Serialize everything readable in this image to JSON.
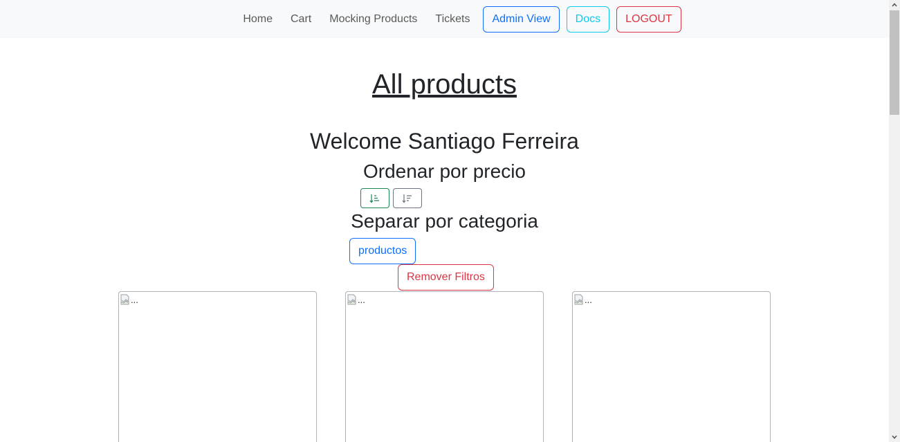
{
  "navbar": {
    "links": {
      "home": "Home",
      "cart": "Cart",
      "mocking": "Mocking Products",
      "tickets": "Tickets"
    },
    "buttons": {
      "admin": "Admin View",
      "docs": "Docs",
      "logout": "LOGOUT"
    }
  },
  "main": {
    "title": "All products",
    "welcome": "Welcome Santiago Ferreira",
    "order_heading": "Ordenar por precio",
    "sort_icons": [
      "sort-ascending-icon",
      "sort-descending-icon"
    ],
    "category_heading": "Separar por categoria",
    "category_button": "productos",
    "remove_filters": "Remover Filtros"
  },
  "products": [
    {
      "alt": "..."
    },
    {
      "alt": "..."
    },
    {
      "alt": "..."
    }
  ],
  "colors": {
    "primary": "#0d6efd",
    "info": "#0dcaf0",
    "danger": "#dc3545",
    "success": "#198754",
    "secondary": "#6c757d",
    "navbar_bg": "#f8f9fa"
  }
}
